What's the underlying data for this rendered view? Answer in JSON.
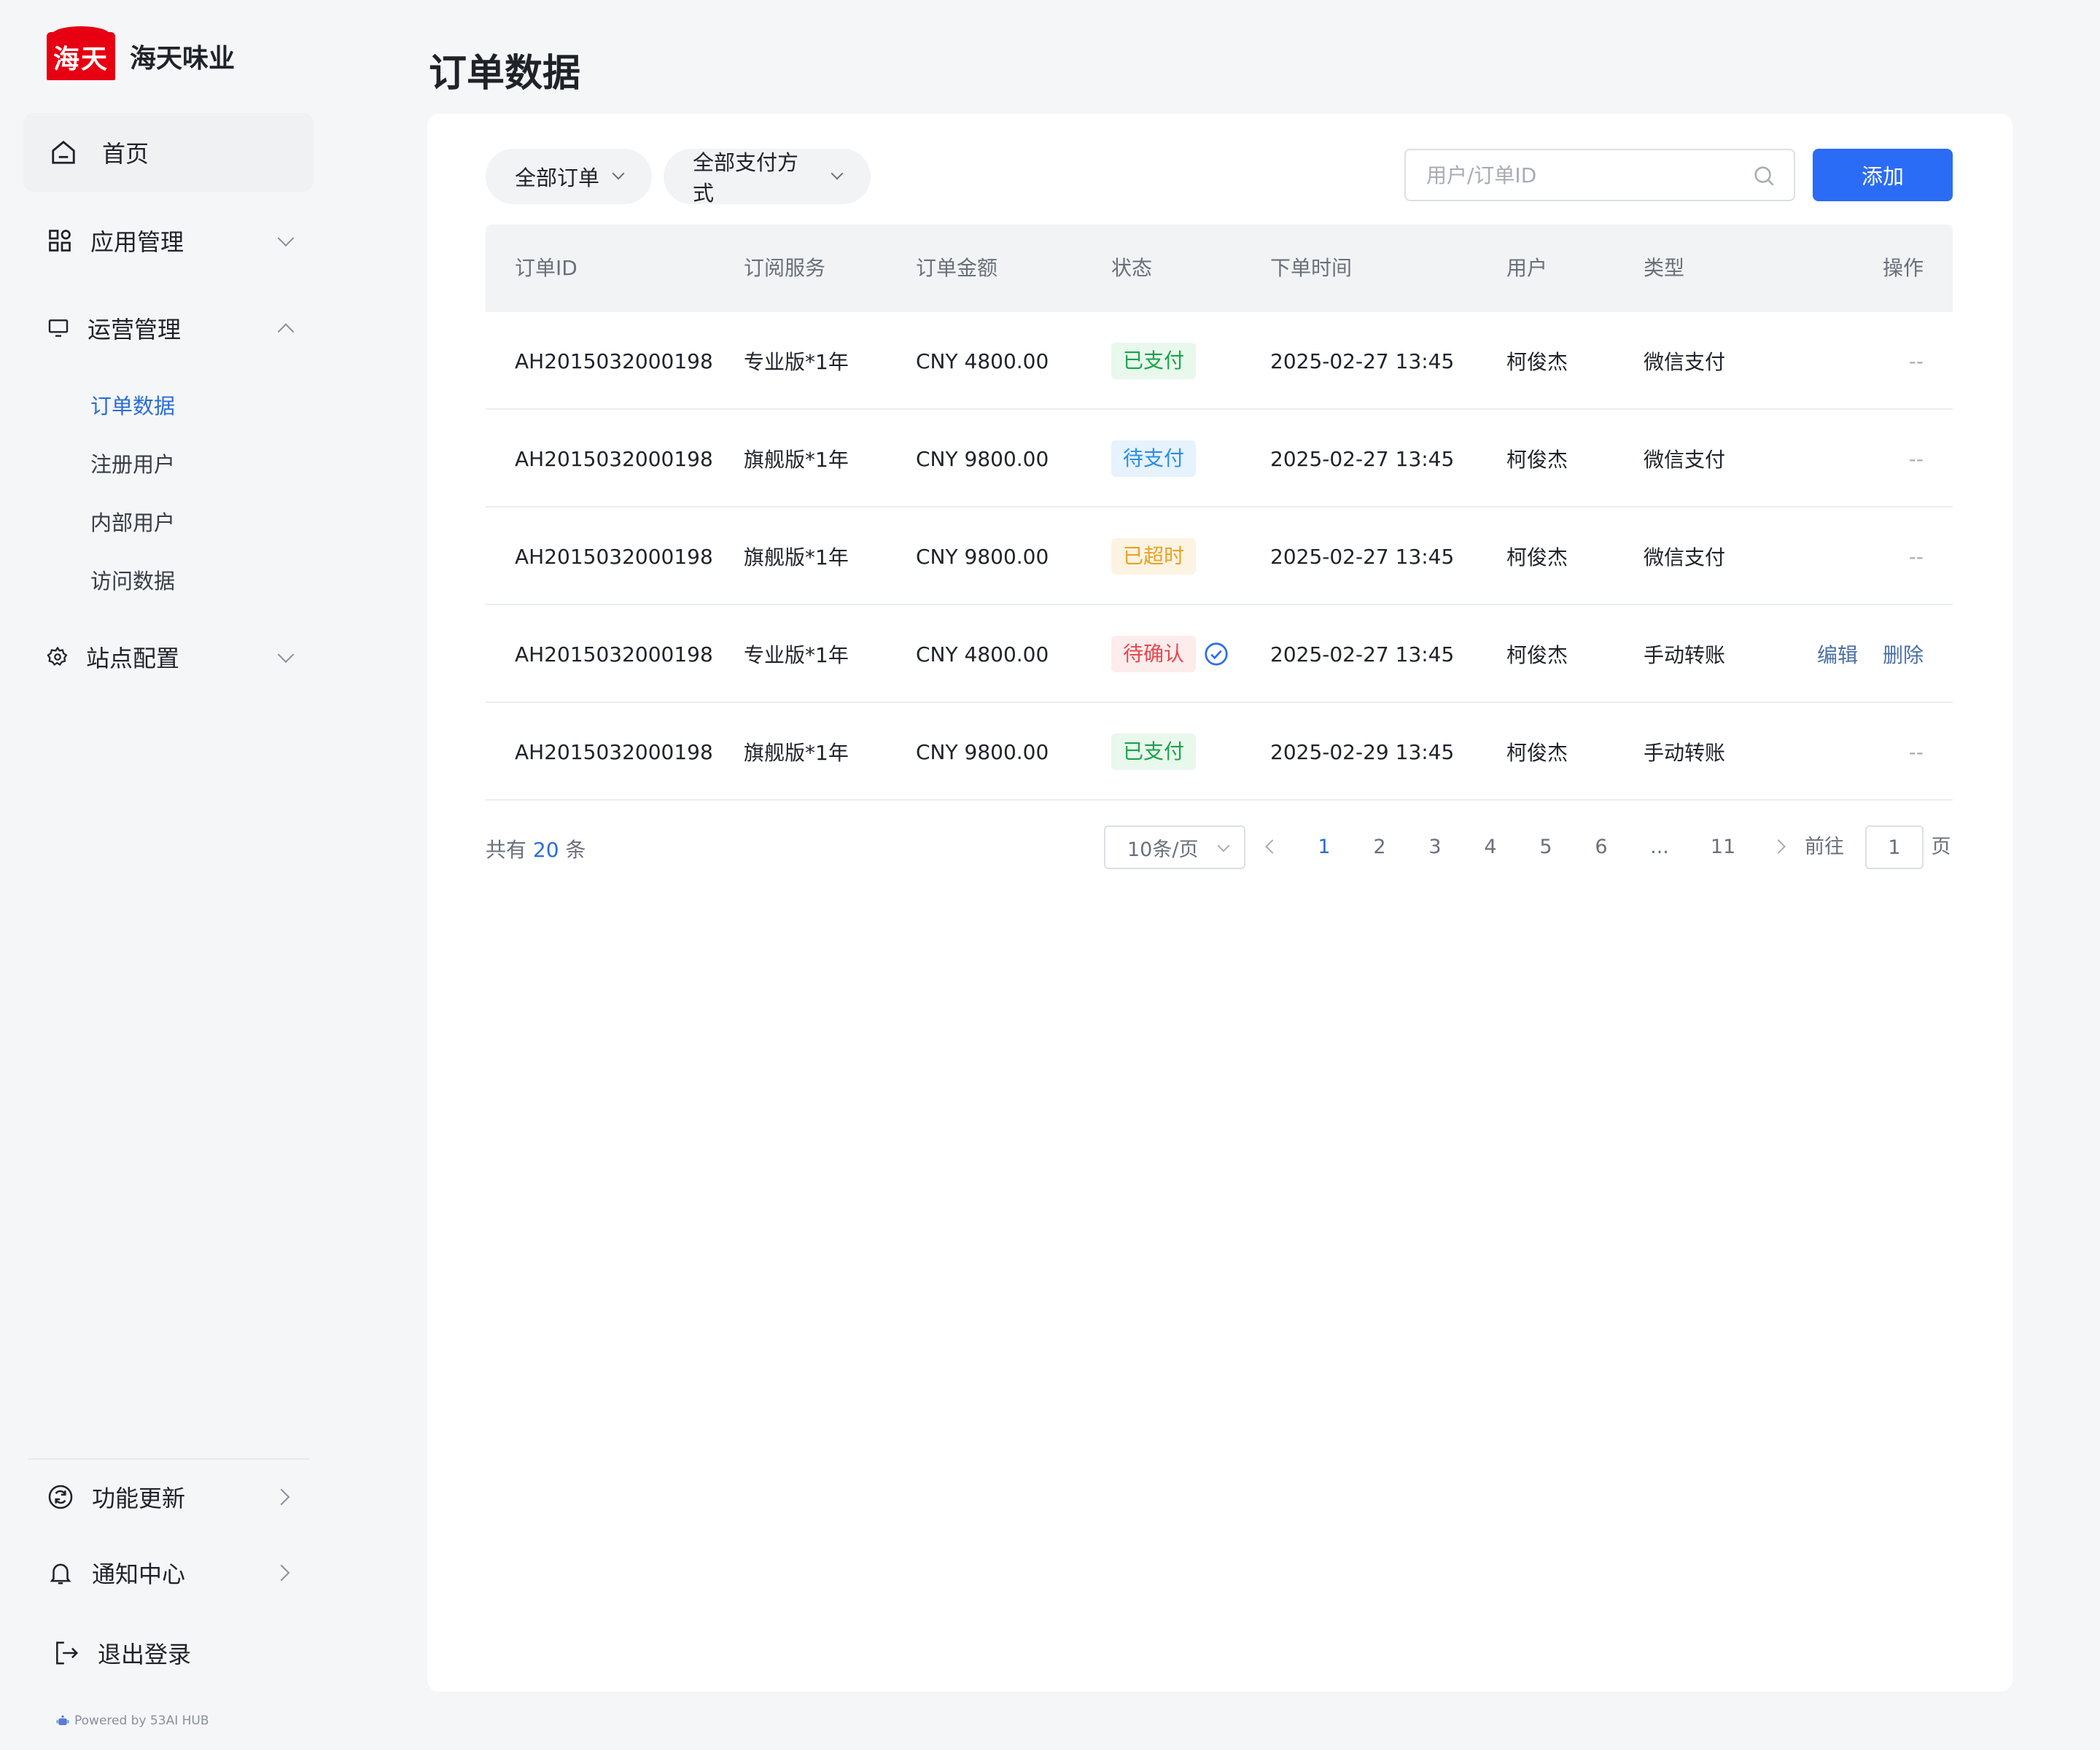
{
  "brand": {
    "logo_text": "海天",
    "name": "海天味业"
  },
  "sidebar": {
    "home": "首页",
    "app_manage": "应用管理",
    "ops_manage": "运营管理",
    "ops_items": [
      "订单数据",
      "注册用户",
      "内部用户",
      "访问数据"
    ],
    "site_config": "站点配置",
    "bottom": {
      "updates": "功能更新",
      "notifications": "通知中心",
      "logout": "退出登录"
    },
    "powered_by": "Powered by 53AI HUB"
  },
  "page": {
    "title": "订单数据"
  },
  "filters": {
    "order_filter": "全部订单",
    "pay_filter": "全部支付方式"
  },
  "search": {
    "placeholder": "用户/订单ID"
  },
  "add_button": "添加",
  "table": {
    "headers": [
      "订单ID",
      "订阅服务",
      "订单金额",
      "状态",
      "下单时间",
      "用户",
      "类型",
      "操作"
    ],
    "rows": [
      {
        "id": "AH2015032000198",
        "service": "专业版*1年",
        "amount": "CNY 4800.00",
        "status": "已支付",
        "time": "2025-02-27 13:45",
        "user": "柯俊杰",
        "type": "微信支付",
        "op": "--"
      },
      {
        "id": "AH2015032000198",
        "service": "旗舰版*1年",
        "amount": "CNY 9800.00",
        "status": "待支付",
        "time": "2025-02-27 13:45",
        "user": "柯俊杰",
        "type": "微信支付",
        "op": "--"
      },
      {
        "id": "AH2015032000198",
        "service": "旗舰版*1年",
        "amount": "CNY 9800.00",
        "status": "已超时",
        "time": "2025-02-27 13:45",
        "user": "柯俊杰",
        "type": "微信支付",
        "op": "--"
      },
      {
        "id": "AH2015032000198",
        "service": "专业版*1年",
        "amount": "CNY 4800.00",
        "status": "待确认",
        "time": "2025-02-27 13:45",
        "user": "柯俊杰",
        "type": "手动转账",
        "op_edit": "编辑",
        "op_delete": "删除"
      },
      {
        "id": "AH2015032000198",
        "service": "旗舰版*1年",
        "amount": "CNY 9800.00",
        "status": "已支付",
        "time": "2025-02-29 13:45",
        "user": "柯俊杰",
        "type": "手动转账",
        "op": "--"
      }
    ]
  },
  "pagination": {
    "total_prefix": "共有",
    "total": "20",
    "total_suffix": "条",
    "page_size": "10条/页",
    "pages": [
      "1",
      "2",
      "3",
      "4",
      "5",
      "6",
      "...",
      "11"
    ],
    "goto_label": "前往",
    "goto_value": "1",
    "page_unit": "页"
  },
  "colors": {
    "accent": "#2b6cf6",
    "brand_red": "#e60012",
    "paid": "#1aa34a",
    "pending": "#2a8ee6",
    "timeout": "#e8a322",
    "confirm": "#e5484d"
  }
}
